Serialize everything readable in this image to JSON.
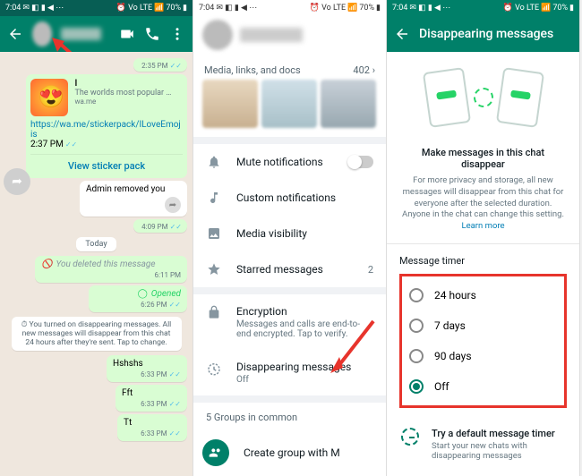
{
  "status": {
    "time": "7:04",
    "battery": "70%",
    "net": "Vo LTE"
  },
  "panel1": {
    "time_top": "2:35 PM",
    "sticker": {
      "title": "I",
      "desc": "The worlds most popular …",
      "domain": "wa.me",
      "link": "https://wa.me/stickerpack/ILoveEmojis",
      "time": "2:37 PM",
      "view": "View sticker pack"
    },
    "admin_removed": "Admin removed you",
    "t409": "4:09 PM",
    "today": "Today",
    "deleted": "You deleted this message",
    "t611": "6:11 PM",
    "opened": "Opened",
    "t626": "6:26 PM",
    "sys_dm": "⏱ You turned on disappearing messages. All new messages will disappear from this chat 24 hours after they're sent. Tap to change.",
    "m1": "Hshshs",
    "m1t": "6:33 PM",
    "m2": "Fft",
    "m2t": "6:33 PM",
    "m3": "Tt",
    "m3t": "6:33 PM"
  },
  "panel2": {
    "media_title": "Media, links, and docs",
    "media_count": "402 ›",
    "mute": "Mute notifications",
    "custom": "Custom notifications",
    "vis": "Media visibility",
    "starred": "Starred messages",
    "starred_count": "2",
    "enc": "Encryption",
    "enc_sub": "Messages and calls are end-to-end encrypted. Tap to verify.",
    "dm": "Disappearing messages",
    "dm_sub": "Off",
    "groups": "5 Groups in common",
    "create": "Create group with M"
  },
  "panel3": {
    "title": "Disappearing messages",
    "head": "Make messages in this chat disappear",
    "body": "For more privacy and storage, all new messages will disappear from this chat for everyone after the selected duration. Anyone in the chat can change this setting. ",
    "learn": "Learn more",
    "timer_label": "Message timer",
    "opts": [
      "24 hours",
      "7 days",
      "90 days",
      "Off"
    ],
    "try_title": "Try a default message timer",
    "try_sub": "Start your new chats with disappearing messages"
  }
}
